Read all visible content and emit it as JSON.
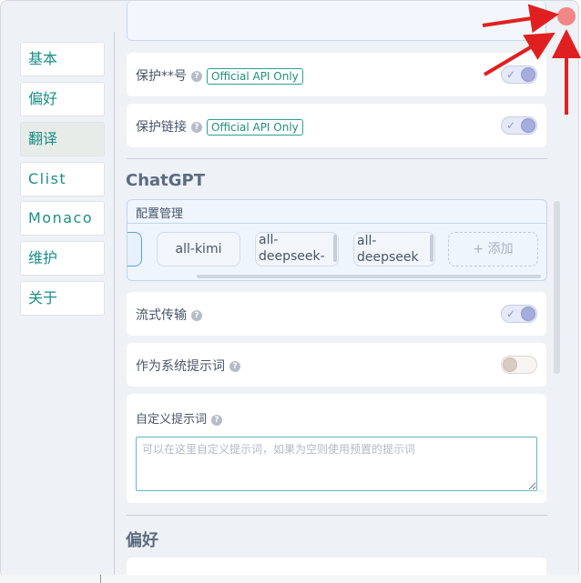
{
  "sidebar": {
    "items": [
      {
        "label": "基本",
        "active": false
      },
      {
        "label": "偏好",
        "active": false
      },
      {
        "label": "翻译",
        "active": true
      },
      {
        "label": "Clist",
        "active": false
      },
      {
        "label": "Monaco",
        "active": false
      },
      {
        "label": "维护",
        "active": false
      },
      {
        "label": "关于",
        "active": false
      }
    ]
  },
  "settings": {
    "protect_number": {
      "label": "保护**号",
      "tag": "Official API Only",
      "enabled": true
    },
    "protect_link": {
      "label": "保护链接",
      "tag": "Official API Only",
      "enabled": true
    }
  },
  "chatgpt": {
    "section_title": "ChatGPT",
    "config": {
      "title": "配置管理",
      "profiles": [
        "all-kimi",
        "all-deepseek-free",
        "all-deepseek"
      ],
      "add_label": "+ 添加"
    },
    "stream": {
      "label": "流式传输",
      "enabled": true
    },
    "as_system_prompt": {
      "label": "作为系统提示词",
      "enabled": false
    },
    "custom_prompt": {
      "label": "自定义提示词",
      "placeholder": "可以在这里自定义提示词，如果为空则使用预置的提示词",
      "value": ""
    }
  },
  "next_section_title": "偏好",
  "colors": {
    "accent_teal": "#1a8f87",
    "toggle_on": "#a6acdb",
    "close_button": "#f28585",
    "annotation_arrow": "#e02020"
  }
}
